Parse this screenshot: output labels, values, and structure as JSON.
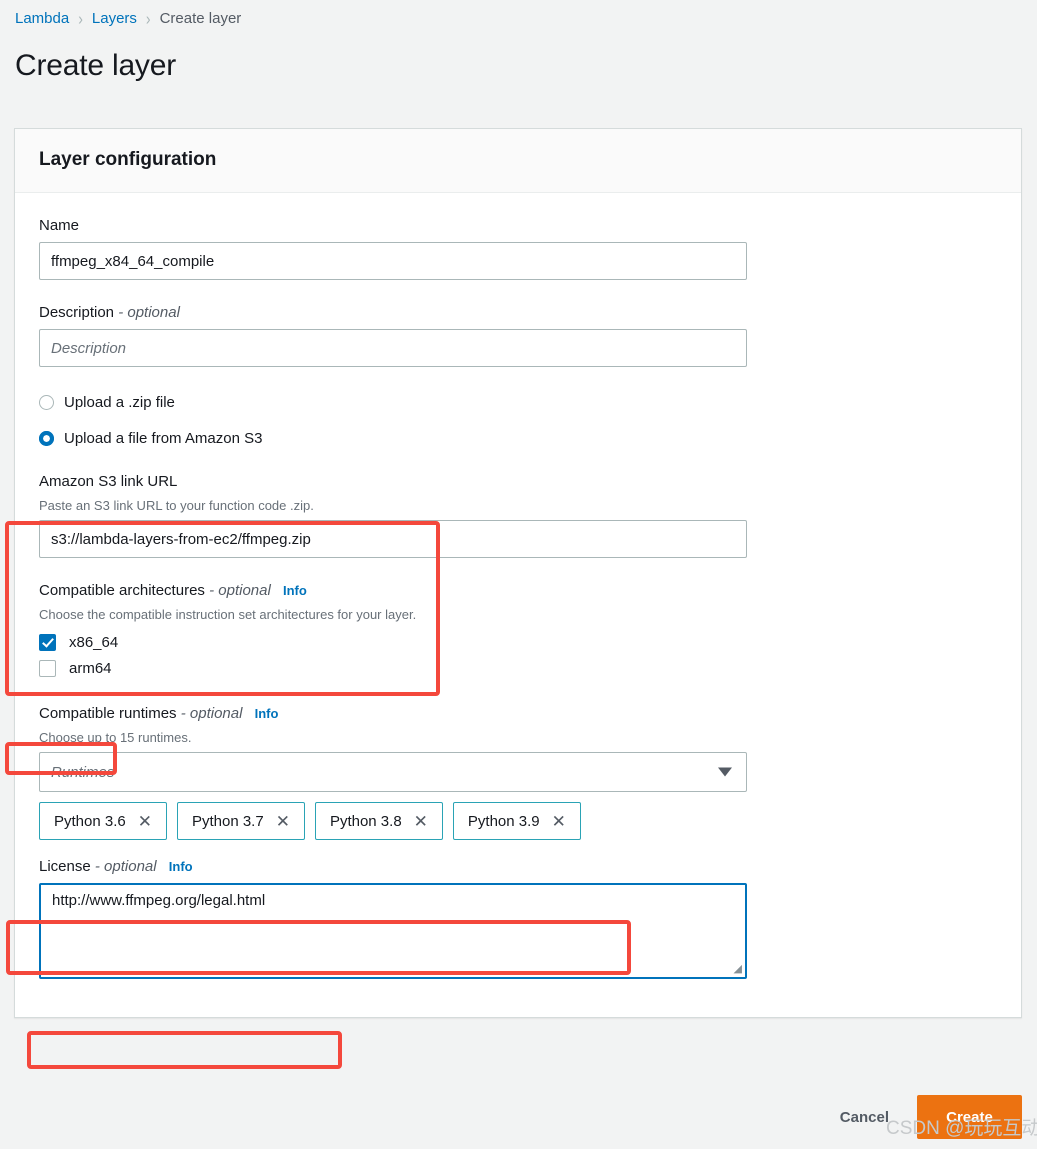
{
  "breadcrumb": {
    "items": [
      {
        "label": "Lambda",
        "current": false
      },
      {
        "label": "Layers",
        "current": false
      },
      {
        "label": "Create layer",
        "current": true
      }
    ],
    "separator": "›"
  },
  "page": {
    "title": "Create layer"
  },
  "card": {
    "header_title": "Layer configuration"
  },
  "name_field": {
    "label": "Name",
    "value": "ffmpeg_x84_64_compile"
  },
  "description_field": {
    "label": "Description",
    "optional": "- optional",
    "placeholder": "Description",
    "value": ""
  },
  "upload_source": {
    "options": [
      {
        "label": "Upload a .zip file",
        "selected": false
      },
      {
        "label": "Upload a file from Amazon S3",
        "selected": true
      }
    ]
  },
  "s3_field": {
    "label": "Amazon S3 link URL",
    "description": "Paste an S3 link URL to your function code .zip.",
    "value": "s3://lambda-layers-from-ec2/ffmpeg.zip"
  },
  "architectures": {
    "label": "Compatible architectures",
    "optional": "- optional",
    "info": "Info",
    "description": "Choose the compatible instruction set architectures for your layer.",
    "options": [
      {
        "label": "x86_64",
        "checked": true
      },
      {
        "label": "arm64",
        "checked": false
      }
    ]
  },
  "runtimes": {
    "label": "Compatible runtimes",
    "optional": "- optional",
    "info": "Info",
    "description": "Choose up to 15 runtimes.",
    "placeholder": "Runtimes",
    "dropdown_icon": "chevron-down-icon",
    "selected": [
      {
        "label": "Python 3.6",
        "remove_icon": "✕"
      },
      {
        "label": "Python 3.7",
        "remove_icon": "✕"
      },
      {
        "label": "Python 3.8",
        "remove_icon": "✕"
      },
      {
        "label": "Python 3.9",
        "remove_icon": "✕"
      }
    ]
  },
  "license": {
    "label": "License",
    "optional": "- optional",
    "info": "Info",
    "value": "http://www.ffmpeg.org/legal.html",
    "resize_grip": "◢"
  },
  "footer": {
    "cancel_label": "Cancel",
    "create_label": "Create"
  },
  "watermark": {
    "text": "CSDN @玩玩互动"
  },
  "colors": {
    "accent_blue": "#0073bb",
    "action_orange": "#ec7211",
    "annotation_red": "#f4483c",
    "token_border": "#2aa3b5",
    "page_background": "#f2f3f3"
  }
}
